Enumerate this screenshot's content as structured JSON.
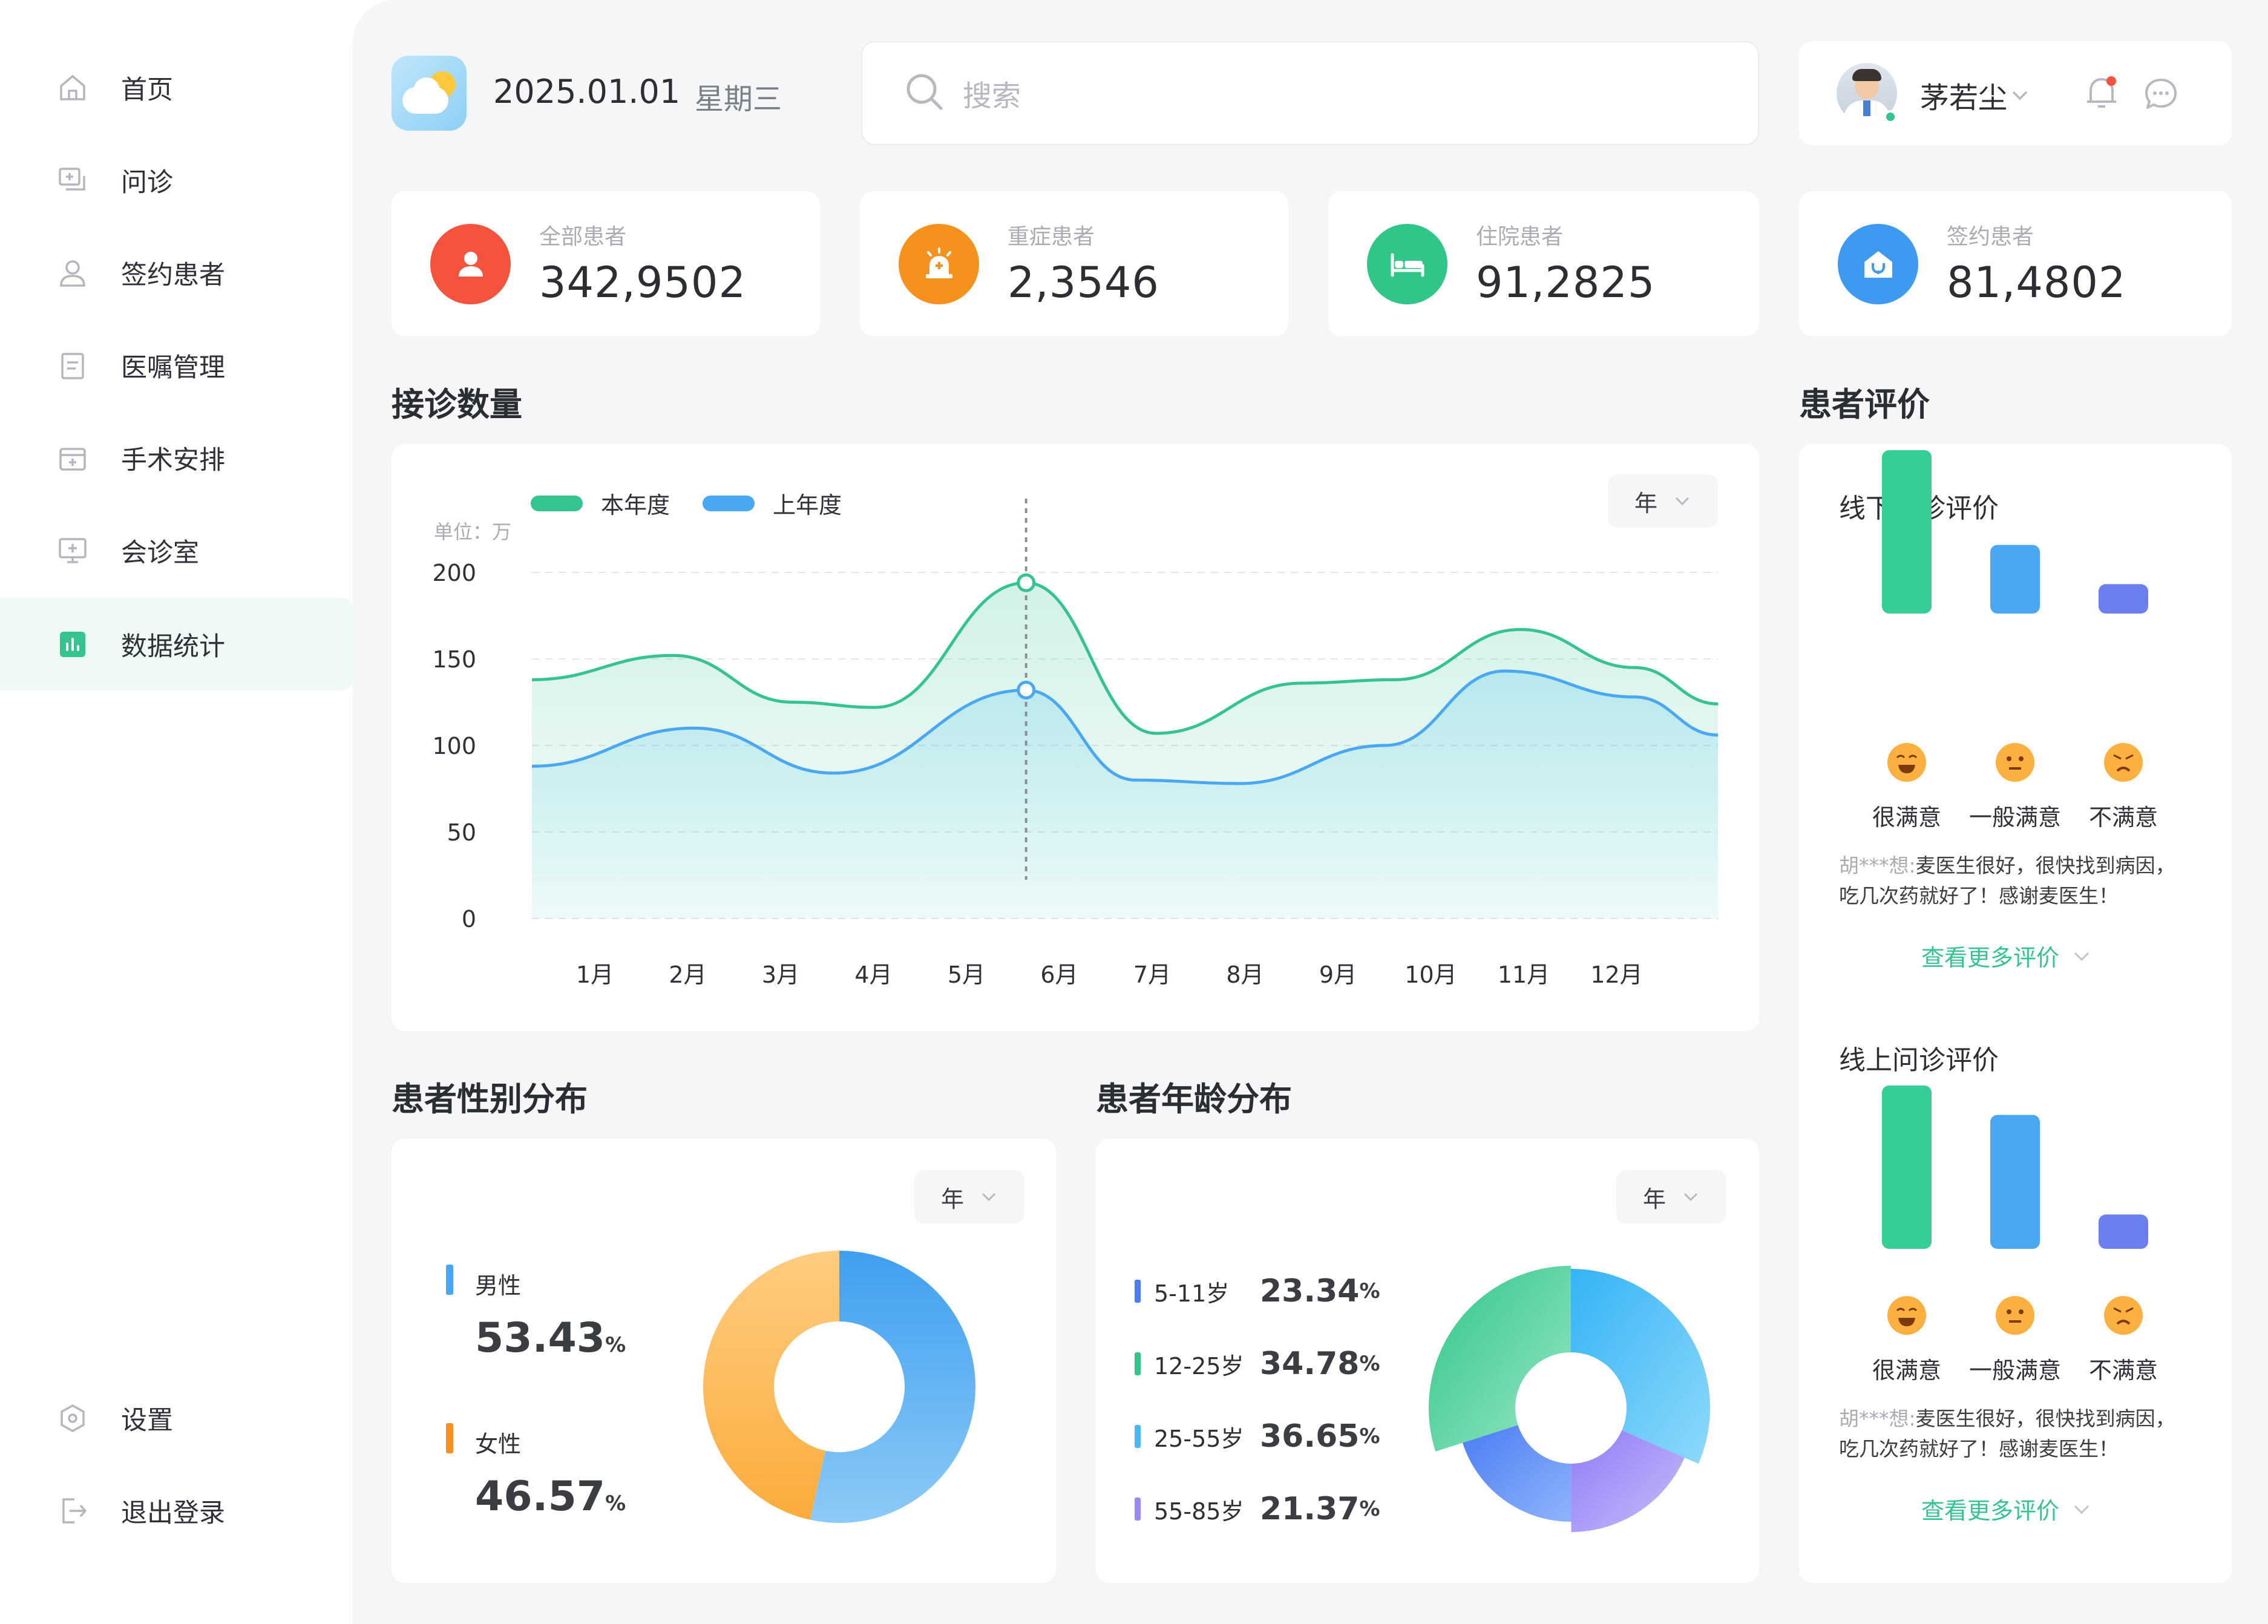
{
  "sidebar": {
    "items": [
      {
        "label": "首页",
        "icon": "home-icon"
      },
      {
        "label": "问诊",
        "icon": "consult-icon"
      },
      {
        "label": "签约患者",
        "icon": "user-icon"
      },
      {
        "label": "医嘱管理",
        "icon": "clipboard-icon"
      },
      {
        "label": "手术安排",
        "icon": "surgery-icon"
      },
      {
        "label": "会诊室",
        "icon": "monitor-icon"
      },
      {
        "label": "数据统计",
        "icon": "bar-chart-icon"
      }
    ],
    "bottom": [
      {
        "label": "设置",
        "icon": "settings-icon"
      },
      {
        "label": "退出登录",
        "icon": "logout-icon"
      }
    ],
    "active_color": "#35c38f"
  },
  "header": {
    "date": "2025.01.01",
    "weekday": "星期三",
    "search_placeholder": "搜索",
    "username": "茅若尘"
  },
  "stats": [
    {
      "label": "全部患者",
      "value": "342,9502",
      "color": "#f5533d",
      "icon": "person-icon"
    },
    {
      "label": "重症患者",
      "value": "2,3546",
      "color": "#f6911e",
      "icon": "alarm-icon"
    },
    {
      "label": "住院患者",
      "value": "91,2825",
      "color": "#2fc687",
      "icon": "bed-icon"
    },
    {
      "label": "签约患者",
      "value": "81,4802",
      "color": "#3d9af0",
      "icon": "house-medical-icon"
    }
  ],
  "visits": {
    "title": "接诊数量",
    "period": "年",
    "unit": "单位：万"
  },
  "chart_data": [
    {
      "type": "area",
      "title": "接诊数量",
      "ylabel": "单位：万",
      "categories": [
        "1月",
        "2月",
        "3月",
        "4月",
        "5月",
        "6月",
        "7月",
        "8月",
        "9月",
        "10月",
        "11月",
        "12月"
      ],
      "yticks": [
        0,
        50,
        100,
        150,
        200
      ],
      "ylim": [
        0,
        200
      ],
      "series": [
        {
          "name": "本年度",
          "color": "#35c38f",
          "x": [
            0,
            1.36,
            2.5,
            3.3,
            4.75,
            6.0,
            7.4,
            8.3,
            9.5,
            10.6,
            11.4
          ],
          "values": [
            138,
            152,
            125,
            122,
            194,
            107,
            136,
            138,
            167,
            145,
            124
          ]
        },
        {
          "name": "上年度",
          "color": "#4aa8f2",
          "x": [
            0,
            1.56,
            2.9,
            4.75,
            5.8,
            6.8,
            8.2,
            9.35,
            10.6,
            11.4
          ],
          "values": [
            88,
            110,
            84,
            132,
            80,
            78,
            100,
            143,
            128,
            106
          ]
        }
      ],
      "highlight": {
        "category": "5月",
        "values": [
          194,
          132
        ]
      },
      "grid": true,
      "legend": "top-left"
    },
    {
      "type": "pie",
      "title": "患者性别分布",
      "labels": [
        "男性",
        "女性"
      ],
      "values": [
        53.43,
        46.57
      ],
      "colors": [
        "#4aa8f2",
        "#fbb040"
      ]
    },
    {
      "type": "pie",
      "title": "患者年龄分布",
      "labels": [
        "5-11岁",
        "12-25岁",
        "25-55岁",
        "55-85岁"
      ],
      "values": [
        23.34,
        34.78,
        36.65,
        21.37
      ],
      "colors": [
        "#4b7cf3",
        "#2fc687",
        "#4ab8f5",
        "#9a8cf5"
      ]
    },
    {
      "type": "bar",
      "title": "线下问诊评价",
      "categories": [
        "很满意",
        "一般满意",
        "不满意"
      ],
      "values": [
        100,
        42,
        18
      ],
      "colors": [
        "#35cf95",
        "#4aa8f2",
        "#6b7ff0"
      ]
    },
    {
      "type": "bar",
      "title": "线上问诊评价",
      "categories": [
        "很满意",
        "一般满意",
        "不满意"
      ],
      "values": [
        100,
        82,
        21
      ],
      "colors": [
        "#35cf95",
        "#4aa8f2",
        "#6b7ff0"
      ]
    }
  ],
  "gender": {
    "title": "患者性别分布",
    "period": "年",
    "male": {
      "label": "男性",
      "value": "53.43",
      "unit": "%"
    },
    "female": {
      "label": "女性",
      "value": "46.57",
      "unit": "%"
    }
  },
  "age": {
    "title": "患者年龄分布",
    "period": "年",
    "rows": [
      {
        "label": "5-11岁",
        "value": "23.34",
        "unit": "%",
        "color": "#4b7cf3"
      },
      {
        "label": "12-25岁",
        "value": "34.78",
        "unit": "%",
        "color": "#2fc687"
      },
      {
        "label": "25-55岁",
        "value": "36.65",
        "unit": "%",
        "color": "#4ab8f5"
      },
      {
        "label": "55-85岁",
        "value": "21.37",
        "unit": "%",
        "color": "#9a8cf5"
      }
    ]
  },
  "reviews": {
    "title": "患者评价",
    "offline": {
      "title": "线下问诊评价",
      "labels": [
        "很满意",
        "一般满意",
        "不满意"
      ],
      "reviewer": "胡***想:",
      "text1": "麦医生很好，很快找到病因，",
      "text2": "吃几次药就好了！感谢麦医生！",
      "more": "查看更多评价"
    },
    "online": {
      "title": "线上问诊评价",
      "labels": [
        "很满意",
        "一般满意",
        "不满意"
      ],
      "reviewer": "胡***想:",
      "text1": "麦医生很好，很快找到病因，",
      "text2": "吃几次药就好了！感谢麦医生！",
      "more": "查看更多评价"
    }
  }
}
